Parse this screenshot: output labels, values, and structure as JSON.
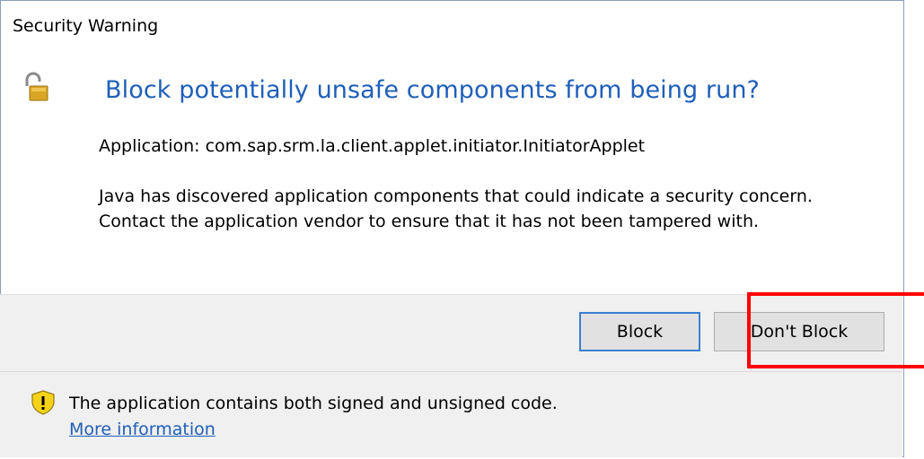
{
  "window": {
    "title": "Security Warning"
  },
  "heading": "Block potentially unsafe components from being run?",
  "application_line": "Application: com.sap.srm.la.client.applet.initiator.InitiatorApplet",
  "description": "Java has discovered application components that could indicate a security concern. Contact the application vendor to ensure that it has not been tampered with.",
  "buttons": {
    "block": "Block",
    "dont_block": "Don't Block"
  },
  "footer": {
    "message": "The application contains both signed and unsigned code.",
    "link": "More information"
  },
  "colors": {
    "heading": "#1f5fb8",
    "highlight": "#ff0000",
    "button_focus": "#3c7fd1",
    "warning_icon": "#f5d21a"
  },
  "icons": {
    "header": "padlock-open-icon",
    "footer": "warning-shield-icon"
  }
}
